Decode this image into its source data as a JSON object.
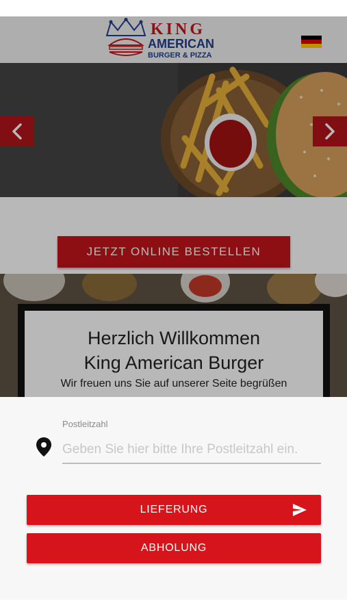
{
  "header": {
    "logo_title": "KING",
    "logo_line2": "AMERICAN",
    "logo_line3": "BURGER & PIZZA",
    "language_flag": "german-flag-icon"
  },
  "hero": {
    "prev_icon": "chevron-left-icon",
    "next_icon": "chevron-right-icon"
  },
  "order": {
    "button_label": "JETZT ONLINE BESTELLEN"
  },
  "welcome": {
    "title_line1": "Herzlich Willkommen",
    "title_line2": "King American Burger",
    "subtitle": "Wir freuen uns Sie auf unserer Seite begrüßen"
  },
  "sheet": {
    "zip_label": "Postleitzahl",
    "zip_placeholder": "Geben Sie hier bitte Ihre Postleitzahl ein.",
    "zip_value": "",
    "location_icon": "map-pin-icon",
    "delivery_label": "LIEFERUNG",
    "delivery_icon": "send-icon",
    "pickup_label": "ABHOLUNG"
  },
  "colors": {
    "brand_red": "#d5141b",
    "logo_blue": "#1f3f8f"
  }
}
